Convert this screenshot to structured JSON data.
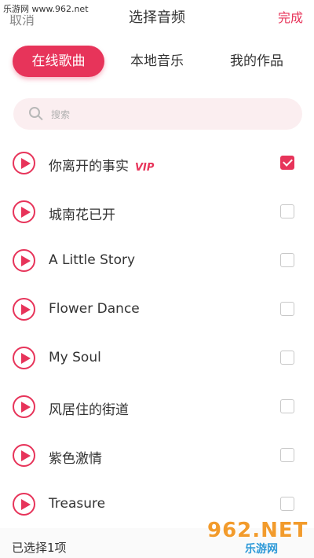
{
  "watermark": "乐游网 www.962.net",
  "header": {
    "cancel_label": "取消",
    "title": "选择音频",
    "done_label": "完成"
  },
  "tabs": [
    {
      "label": "在线歌曲",
      "active": true
    },
    {
      "label": "本地音乐",
      "active": false
    },
    {
      "label": "我的作品",
      "active": false
    }
  ],
  "search": {
    "placeholder": "搜索",
    "value": ""
  },
  "songs": [
    {
      "name": "你离开的事实",
      "badge": "VIP",
      "checked": true
    },
    {
      "name": "城南花已开",
      "badge": "",
      "checked": false
    },
    {
      "name": "A Little Story",
      "badge": "",
      "checked": false
    },
    {
      "name": "Flower Dance",
      "badge": "",
      "checked": false
    },
    {
      "name": "My Soul",
      "badge": "",
      "checked": false
    },
    {
      "name": "风居住的街道",
      "badge": "",
      "checked": false
    },
    {
      "name": "紫色激情",
      "badge": "",
      "checked": false
    },
    {
      "name": "Treasure",
      "badge": "",
      "checked": false
    }
  ],
  "footer": {
    "selected_count": "已选择1项"
  },
  "logo": {
    "top": "962.NET",
    "bottom": "乐游网"
  },
  "colors": {
    "accent": "#e7345a",
    "search_bg": "#fbeef0"
  }
}
